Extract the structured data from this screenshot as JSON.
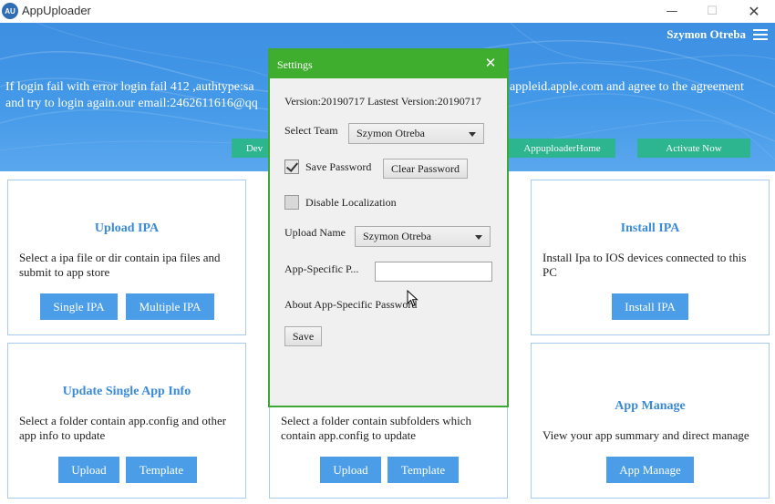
{
  "window": {
    "logo_text": "AU",
    "title": "AppUploader",
    "minimize_glyph": "—",
    "maximize_glyph": "☐",
    "close_glyph": "✕"
  },
  "banner": {
    "user_name": "Szymon Otreba",
    "notice_line1": "If login fail with error login fail 412 ,authtype:sa",
    "notice_line1_right": "appleid.apple.com and agree to the agreement",
    "notice_line2": "and try to login again.our email:2462611616@qq",
    "buttons": [
      "Dev",
      "AppuploaderHome",
      "Activate Now"
    ]
  },
  "cards": {
    "upload_ipa": {
      "title": "Upload IPA",
      "desc": "Select a ipa file or dir contain ipa files and submit to app store",
      "buttons": [
        "Single IPA",
        "Multiple IPA"
      ]
    },
    "install_ipa": {
      "title": "Install IPA",
      "desc": "Install Ipa to IOS devices connected to this PC",
      "buttons": [
        "Install IPA"
      ]
    },
    "update_single": {
      "title": "Update Single App Info",
      "desc": "Select a folder contain app.config and other app info to update",
      "buttons": [
        "Upload",
        "Template"
      ]
    },
    "update_multi": {
      "desc": "Select a folder contain subfolders which contain app.config to update",
      "buttons": [
        "Upload",
        "Template"
      ]
    },
    "app_manage": {
      "title": "App Manage",
      "desc": "View your app summary and direct manage",
      "buttons": [
        "App Manage"
      ]
    }
  },
  "settings": {
    "title": "Settings",
    "close_glyph": "✕",
    "version_text": "Version:20190717 Lastest Version:20190717",
    "select_team_label": "Select Team",
    "select_team_value": "Szymon Otreba",
    "save_password_label": "Save Password",
    "save_password_checked": true,
    "clear_password_button": "Clear Password",
    "disable_localization_label": "Disable Localization",
    "disable_localization_checked": false,
    "upload_name_label": "Upload Name",
    "upload_name_value": "Szymon Otreba",
    "app_specific_label": "App-Specific P...",
    "app_specific_value": "",
    "about_link": "About App-Specific Password",
    "save_button": "Save"
  },
  "colors": {
    "banner_blue": "#4499e8",
    "accent_green": "#3fae2f",
    "teal_button": "#2cb58f",
    "card_button": "#4a9de6",
    "card_title": "#3b8ad9"
  }
}
